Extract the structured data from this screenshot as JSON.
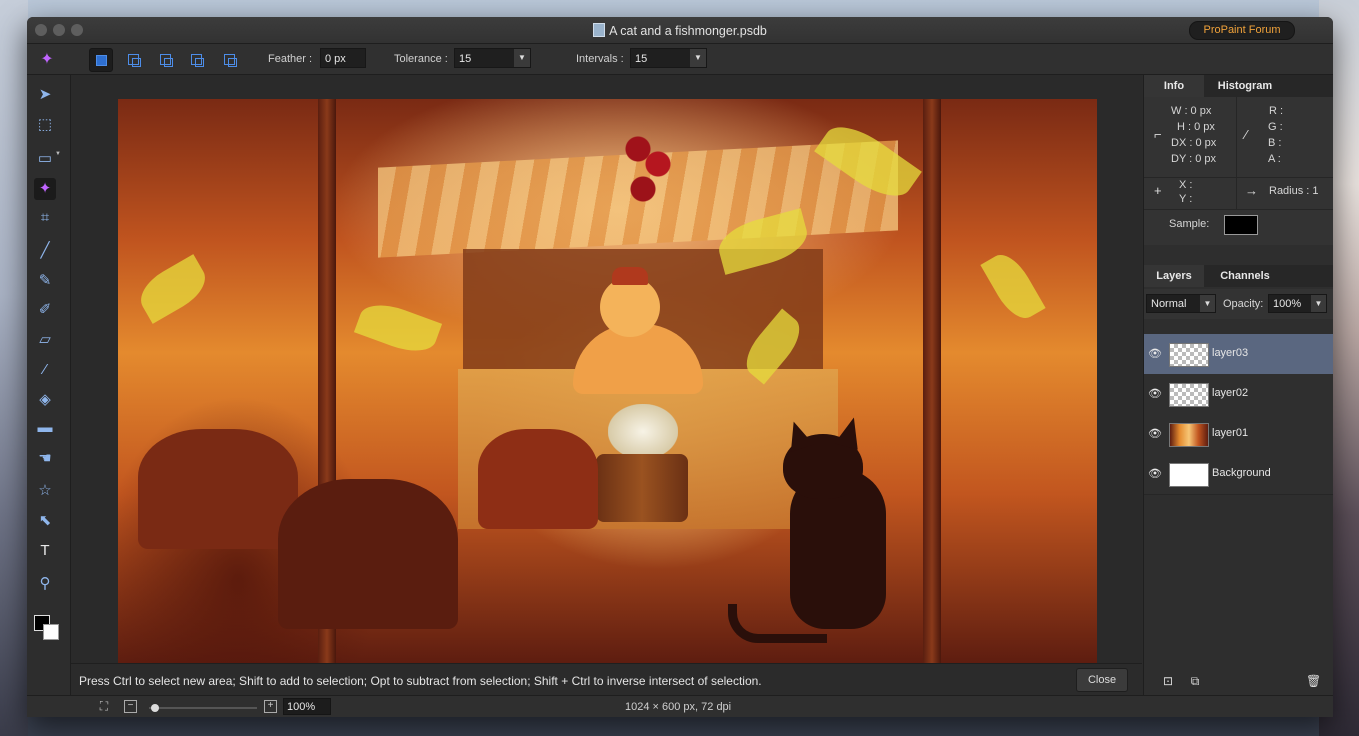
{
  "window": {
    "title": "A cat and a fishmonger.psdb",
    "forum_button": "ProPaint Forum"
  },
  "options": {
    "feather_label": "Feather :",
    "feather_value": "0 px",
    "tolerance_label": "Tolerance :",
    "tolerance_value": "15",
    "intervals_label": "Intervals :",
    "intervals_value": "15"
  },
  "toolbar": {
    "tools": [
      "move-tool-icon",
      "transform-tool-icon",
      "marquee-tool-icon",
      "magic-wand-tool-icon",
      "crop-tool-icon",
      "brush-tool-icon",
      "pencil-tool-icon",
      "smudge-tool-icon",
      "eraser-tool-icon",
      "eyedropper-tool-icon",
      "paint-bucket-tool-icon",
      "gradient-tool-icon",
      "hand-tool-icon",
      "shape-tool-icon",
      "direct-selection-tool-icon",
      "text-tool-icon",
      "zoom-tool-icon"
    ],
    "selected": "magic-wand-tool-icon"
  },
  "status": {
    "message": "Press Ctrl to select new area; Shift to add to selection; Opt to subtract from selection; Shift + Ctrl to inverse intersect of selection.",
    "close_label": "Close"
  },
  "bottom": {
    "zoom": "100%",
    "document_info": "1024 × 600 px, 72 dpi"
  },
  "info_panel": {
    "tab_info": "Info",
    "tab_histogram": "Histogram",
    "w": "W :  0 px",
    "h": "H :  0 px",
    "dx": "DX :  0 px",
    "dy": "DY :  0 px",
    "r": "R :",
    "g": "G :",
    "b": "B :",
    "a": "A :",
    "x": "X :",
    "y": "Y :",
    "radius": "Radius :  1",
    "sample": "Sample:"
  },
  "layers_panel": {
    "tab_layers": "Layers",
    "tab_channels": "Channels",
    "blend_mode": "Normal",
    "opacity_label": "Opacity:",
    "opacity_value": "100%",
    "layers": [
      {
        "name": "layer03",
        "selected": true
      },
      {
        "name": "layer02",
        "selected": false
      },
      {
        "name": "layer01",
        "selected": false
      },
      {
        "name": "Background",
        "selected": false
      }
    ]
  },
  "colors": {
    "accent_purple": "#c065ff",
    "tool_blue": "#8fb6ec",
    "forum_orange": "#f0a23a",
    "layer_selected": "#5a6780"
  }
}
